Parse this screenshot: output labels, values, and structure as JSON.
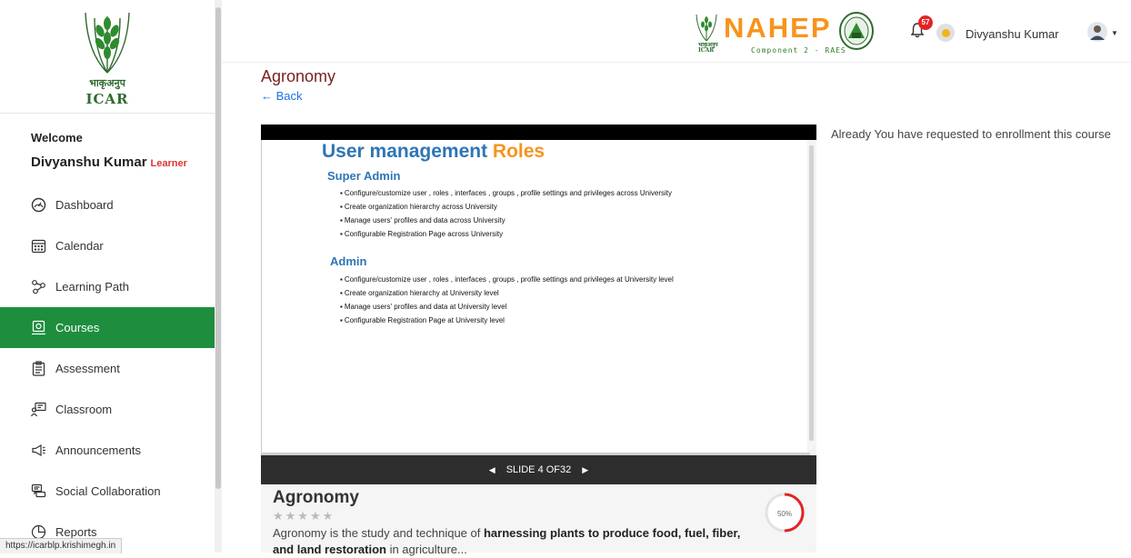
{
  "sidebar": {
    "logo_hindi": "भाकृअनुप",
    "logo_text": "ICAR",
    "welcome": "Welcome",
    "user_name": "Divyanshu Kumar",
    "user_role": "Learner",
    "items": [
      {
        "label": "Dashboard",
        "icon": "dashboard-icon"
      },
      {
        "label": "Calendar",
        "icon": "calendar-icon"
      },
      {
        "label": "Learning Path",
        "icon": "learning-path-icon"
      },
      {
        "label": "Courses",
        "icon": "courses-icon",
        "active": true
      },
      {
        "label": "Assessment",
        "icon": "assessment-icon"
      },
      {
        "label": "Classroom",
        "icon": "classroom-icon"
      },
      {
        "label": "Announcements",
        "icon": "megaphone-icon"
      },
      {
        "label": "Social Collaboration",
        "icon": "chat-icon"
      },
      {
        "label": "Reports",
        "icon": "pie-chart-icon"
      }
    ]
  },
  "header": {
    "brand_emblem_text": "भाकृअनुप ICAR",
    "brand": "NAHEP",
    "brand_sub": "Component 2 - RAES",
    "notification_count": "57",
    "user_name": "Divyanshu Kumar"
  },
  "main": {
    "title": "Agronomy",
    "back_label": "← Back",
    "enroll_note": "Already You have requested to enrollment this course"
  },
  "slide": {
    "title_main": "User management",
    "title_highlight": "Roles",
    "section1": "Super Admin",
    "section1_bullets": [
      "Configure/customize user , roles , interfaces , groups , profile settings and privileges across University",
      "Create organization hierarchy across University",
      "Manage users' profiles and data across University",
      "Configurable Registration Page across University"
    ],
    "section2": "Admin",
    "section2_bullets": [
      "Configure/customize user , roles , interfaces , groups , profile settings and privileges at University level",
      "Create organization hierarchy at University level",
      "Manage users' profiles and data at University level",
      "Configurable Registration Page at University level"
    ],
    "nav_label": "SLIDE 4 OF32",
    "current": 4,
    "total": 32
  },
  "course": {
    "title": "Agronomy",
    "stars": "★★★★★",
    "rating": 0,
    "desc_prefix": "Agronomy is the study and technique of ",
    "desc_bold1": "harnessing plants to produce food, fuel, fiber, and land restoration",
    "desc_suffix": " in agriculture...",
    "progress_label": "50%",
    "progress_fraction": 0.5
  },
  "status_url": "https://icarblp.krishimegh.in",
  "colors": {
    "accent_green": "#1e8e3e",
    "title_maroon": "#7a1f1f",
    "slide_blue": "#2e75b6",
    "slide_orange": "#f7941d",
    "badge_red": "#e22424"
  }
}
